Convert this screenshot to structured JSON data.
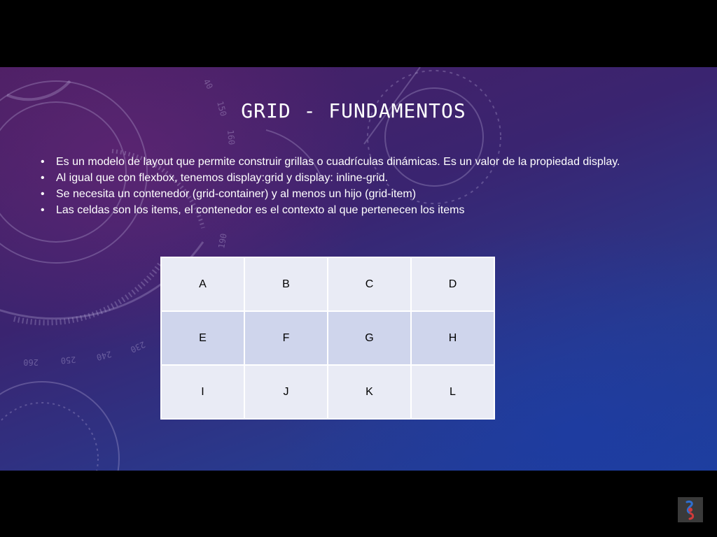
{
  "slide": {
    "title": "GRID - FUNDAMENTOS",
    "bullets": [
      "Es un modelo de layout que permite construir grillas o cuadrículas dinámicas. Es un valor de la propiedad display.",
      "Al igual que con flexbox, tenemos display:grid y display: inline-grid.",
      "Se necesita un contenedor (grid-container) y al menos un hijo (grid-item)",
      "Las celdas son los items, el contenedor es el contexto al que pertenecen los items"
    ],
    "bullet_symbol": "•",
    "grid_cells": [
      [
        "A",
        "B",
        "C",
        "D"
      ],
      [
        "E",
        "F",
        "G",
        "H"
      ],
      [
        "I",
        "J",
        "K",
        "L"
      ]
    ]
  },
  "decoration_labels": [
    "40",
    "150",
    "160",
    "190",
    "260",
    "250",
    "240",
    "230"
  ],
  "colors": {
    "background_top": "#4a1f63",
    "background_bottom": "#1f3f9c",
    "cell_light": "#e9ebf5",
    "cell_mid": "#cfd5ec",
    "title_text": "#ffffff"
  },
  "icons": {
    "logo": "channel-logo-icon"
  }
}
